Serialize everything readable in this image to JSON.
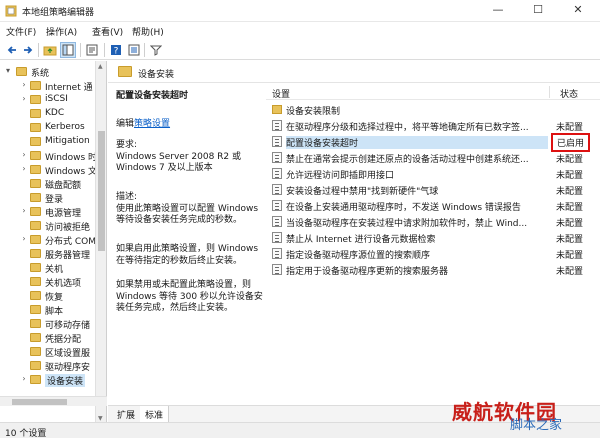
{
  "window": {
    "title": "本地组策略编辑器",
    "min": "—",
    "max": "☐",
    "close": "✕"
  },
  "menu": [
    "文件(F)",
    "操作(A)",
    "查看(V)",
    "帮助(H)"
  ],
  "toolbar": [
    "back-icon",
    "forward-icon",
    "up-folder-icon",
    "show-hide-tree-icon",
    "export-list-icon",
    "help-icon",
    "properties-icon",
    "filter-icon"
  ],
  "tree": [
    {
      "label": "系统",
      "caret": "▾",
      "level": 0
    },
    {
      "label": "Internet 通",
      "caret": "›",
      "level": 1
    },
    {
      "label": "iSCSI",
      "caret": "›",
      "level": 1
    },
    {
      "label": "KDC",
      "caret": "",
      "level": 1
    },
    {
      "label": "Kerberos",
      "caret": "",
      "level": 1
    },
    {
      "label": "Mitigation",
      "caret": "",
      "level": 1
    },
    {
      "label": "Windows 时",
      "caret": "›",
      "level": 1
    },
    {
      "label": "Windows 文",
      "caret": "›",
      "level": 1
    },
    {
      "label": "磁盘配额",
      "caret": "",
      "level": 1
    },
    {
      "label": "登录",
      "caret": "",
      "level": 1
    },
    {
      "label": "电源管理",
      "caret": "›",
      "level": 1
    },
    {
      "label": "访问被拒绝",
      "caret": "",
      "level": 1
    },
    {
      "label": "分布式 COM",
      "caret": "›",
      "level": 1
    },
    {
      "label": "服务器管理",
      "caret": "",
      "level": 1
    },
    {
      "label": "关机",
      "caret": "",
      "level": 1
    },
    {
      "label": "关机选项",
      "caret": "",
      "level": 1
    },
    {
      "label": "恢复",
      "caret": "",
      "level": 1
    },
    {
      "label": "脚本",
      "caret": "",
      "level": 1
    },
    {
      "label": "可移动存储",
      "caret": "",
      "level": 1
    },
    {
      "label": "凭据分配",
      "caret": "",
      "level": 1
    },
    {
      "label": "区域设置服",
      "caret": "",
      "level": 1
    },
    {
      "label": "驱动程序安",
      "caret": "",
      "level": 1
    },
    {
      "label": "设备安装",
      "caret": "›",
      "level": 1,
      "selected": true
    }
  ],
  "pane": {
    "title": "设备安装"
  },
  "description": {
    "heading": "配置设备安装超时",
    "edit_prefix": "编辑",
    "edit_link": "策略设置",
    "requirements": "要求:\nWindows Server 2008 R2 或 Windows 7 及以上版本",
    "desc": "描述:\n使用此策略设置可以配置 Windows 等待设备安装任务完成的秒数。",
    "if_enabled": "如果启用此策略设置，则 Windows 在等待指定的秒数后终止安装。",
    "if_disabled": "如果禁用或未配置此策略设置，则 Windows 等待 300 秒以允许设备安装任务完成，然后终止安装。"
  },
  "list": {
    "col_setting": "设置",
    "col_state": "状态",
    "rows": [
      {
        "name": "设备安装限制",
        "state": "",
        "folder": true
      },
      {
        "name": "在驱动程序分级和选择过程中，将平等地确定所有已数字签...",
        "state": "未配置"
      },
      {
        "name": "配置设备安装超时",
        "state": "已启用",
        "selected": true,
        "enabled": true
      },
      {
        "name": "禁止在通常会提示创建还原点的设备活动过程中创建系统还...",
        "state": "未配置"
      },
      {
        "name": "允许远程访问即插即用接口",
        "state": "未配置"
      },
      {
        "name": "安装设备过程中禁用\"找到新硬件\"气球",
        "state": "未配置"
      },
      {
        "name": "在设备上安装通用驱动程序时，不发送 Windows 错误报告",
        "state": "未配置"
      },
      {
        "name": "当设备驱动程序在安装过程中请求附加软件时，禁止 Wind...",
        "state": "未配置"
      },
      {
        "name": "禁止从 Internet 进行设备元数据检索",
        "state": "未配置"
      },
      {
        "name": "指定设备驱动程序源位置的搜索顺序",
        "state": "未配置"
      },
      {
        "name": "指定用于设备驱动程序更新的搜索服务器",
        "state": "未配置"
      }
    ]
  },
  "tabs": [
    "扩展",
    "标准"
  ],
  "status": "10 个设置",
  "watermark": {
    "red": "威航软件园",
    "blue": "脚本之家"
  }
}
